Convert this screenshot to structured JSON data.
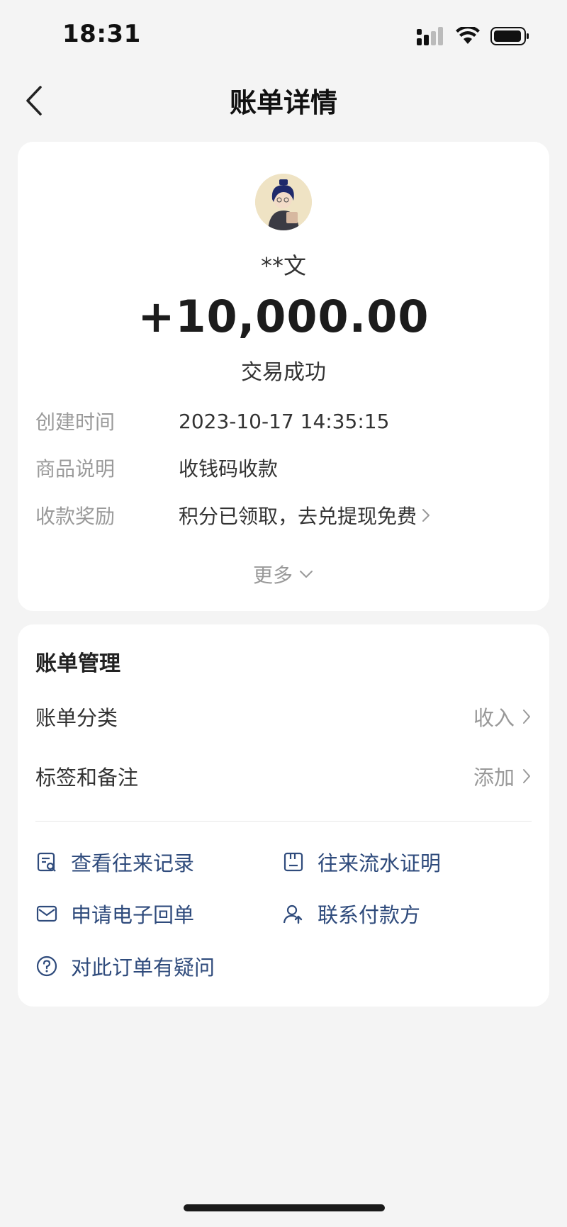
{
  "status_bar": {
    "time": "18:31"
  },
  "nav": {
    "title": "账单详情"
  },
  "summary": {
    "payer_name": "**文",
    "amount": "+10,000.00",
    "status": "交易成功"
  },
  "details": [
    {
      "label": "创建时间",
      "value": "2023-10-17 14:35:15"
    },
    {
      "label": "商品说明",
      "value": "收钱码收款"
    },
    {
      "label": "收款奖励",
      "value": "积分已领取，去兑提现免费"
    }
  ],
  "more_label": "更多",
  "management": {
    "title": "账单管理",
    "rows": [
      {
        "label": "账单分类",
        "value": "收入"
      },
      {
        "label": "标签和备注",
        "value": "添加"
      }
    ]
  },
  "actions": [
    {
      "label": "查看往来记录",
      "icon": "record-search-icon"
    },
    {
      "label": "往来流水证明",
      "icon": "document-icon"
    },
    {
      "label": "申请电子回单",
      "icon": "envelope-icon"
    },
    {
      "label": "联系付款方",
      "icon": "contact-user-icon"
    },
    {
      "label": "对此订单有疑问",
      "icon": "question-circle-icon"
    }
  ],
  "colors": {
    "accent": "#2f4b7c",
    "background": "#f4f4f4",
    "card": "#ffffff"
  }
}
